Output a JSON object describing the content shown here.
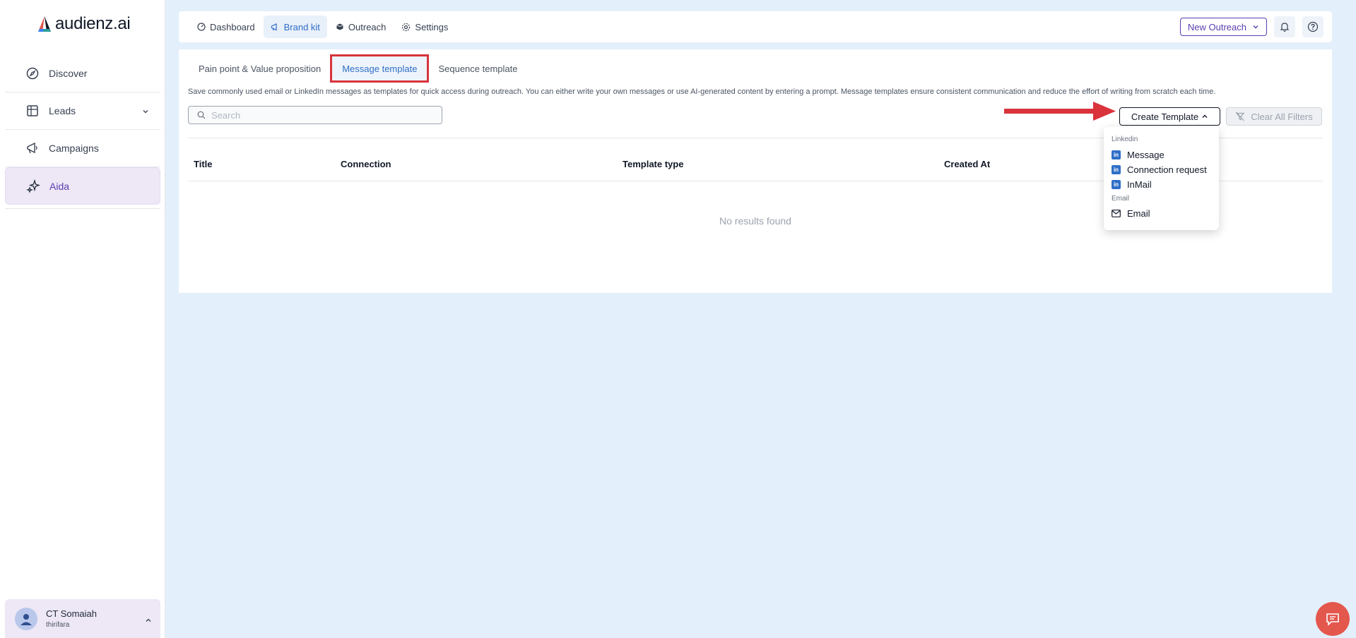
{
  "app": {
    "logo_text": "audienz.ai"
  },
  "sidebar": {
    "items": [
      {
        "label": "Discover",
        "icon": "compass-icon"
      },
      {
        "label": "Leads",
        "icon": "table-icon"
      },
      {
        "label": "Campaigns",
        "icon": "megaphone-icon"
      },
      {
        "label": "Aida",
        "icon": "sparkles-icon"
      }
    ],
    "user": {
      "name": "CT Somaiah",
      "sub": "thirifara"
    }
  },
  "topbar": {
    "tabs": [
      {
        "label": "Dashboard",
        "icon": "dashboard-icon"
      },
      {
        "label": "Brand kit",
        "icon": "megaphone-icon"
      },
      {
        "label": "Outreach",
        "icon": "box-icon"
      },
      {
        "label": "Settings",
        "icon": "gear-icon"
      }
    ],
    "new_outreach_label": "New Outreach"
  },
  "page": {
    "subtabs": [
      "Pain point & Value proposition",
      "Message template",
      "Sequence template"
    ],
    "description": "Save commonly used email or LinkedIn messages as templates for quick access during outreach. You can either write your own messages or use AI-generated content by entering a prompt. Message templates ensure consistent communication and reduce the effort of writing from scratch each time.",
    "search_placeholder": "Search",
    "create_template_label": "Create Template",
    "clear_filters_label": "Clear All Filters",
    "columns": [
      "Title",
      "Connection",
      "Template type",
      "Created At"
    ],
    "empty_text": "No results found"
  },
  "dropdown": {
    "linkedin_heading": "Linkedin",
    "linkedin_items": [
      "Message",
      "Connection request",
      "InMail"
    ],
    "email_heading": "Email",
    "email_items": [
      "Email"
    ]
  },
  "colors": {
    "accent": "#5b3db0",
    "brand_blue": "#2f6fc7",
    "highlight_red": "#d9333b",
    "background": "#e3effa"
  }
}
